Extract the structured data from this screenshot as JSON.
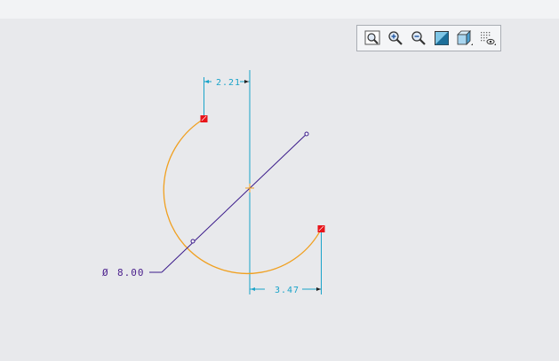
{
  "toolbar": {
    "buttons": [
      {
        "icon": "zoom-fit-icon"
      },
      {
        "icon": "zoom-in-icon"
      },
      {
        "icon": "zoom-out-icon"
      },
      {
        "icon": "display-style-icon"
      },
      {
        "icon": "view-orientation-icon"
      },
      {
        "icon": "sketcher-display-icon"
      }
    ]
  },
  "sketch": {
    "dim_top": "2.21",
    "dim_bottom": "3.47",
    "diameter_symbol": "Ø",
    "diameter_value": "8.00"
  },
  "colors": {
    "arc": "#f0a020",
    "centerline": "#19a3c9",
    "dimension": "#19a3c9",
    "construction": "#3a1a8a",
    "endpoint": "#e8141a"
  }
}
